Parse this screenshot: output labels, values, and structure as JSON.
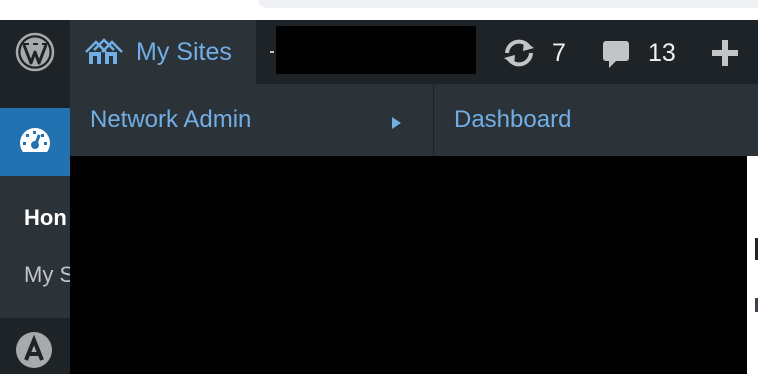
{
  "adminbar": {
    "my_sites_label": "My Sites",
    "updates_count": "7",
    "comments_count": "13"
  },
  "dropdown": {
    "network_admin_label": "Network Admin",
    "flyout_dashboard_label": "Dashboard"
  },
  "sidebar": {
    "submenu_home_label": "Hon",
    "submenu_mysites_label": "My S"
  },
  "colors": {
    "bar_bg": "#1d2327",
    "menu_bg": "#2c3338",
    "accent_link": "#72aee6",
    "active_blue": "#2271b1"
  },
  "icons": [
    "wordpress-logo-icon",
    "my-sites-icon",
    "updates-icon",
    "comments-icon",
    "new-content-plus-icon",
    "dashboard-gauge-icon",
    "astra-icon",
    "submenu-arrow-icon"
  ]
}
